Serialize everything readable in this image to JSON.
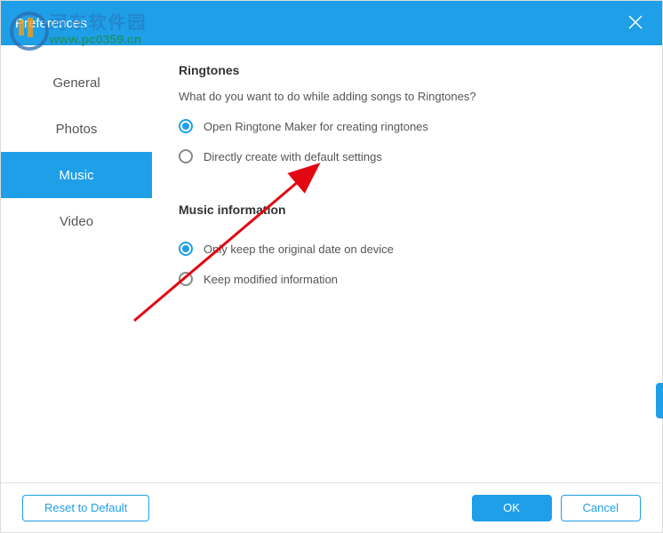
{
  "window": {
    "title": "Preferences"
  },
  "watermark": {
    "cn": "河东软件园",
    "url": "www.pc0359.cn"
  },
  "sidebar": {
    "items": [
      {
        "label": "General"
      },
      {
        "label": "Photos"
      },
      {
        "label": "Music"
      },
      {
        "label": "Video"
      }
    ]
  },
  "sections": {
    "ringtones": {
      "title": "Ringtones",
      "desc": "What do you want to do while adding songs to Ringtones?",
      "opt1": "Open Ringtone Maker for creating ringtones",
      "opt2": "Directly create with default settings"
    },
    "musicinfo": {
      "title": "Music information",
      "opt1": "Only keep the original date on device",
      "opt2": "Keep modified information"
    }
  },
  "footer": {
    "reset": "Reset to Default",
    "ok": "OK",
    "cancel": "Cancel"
  }
}
